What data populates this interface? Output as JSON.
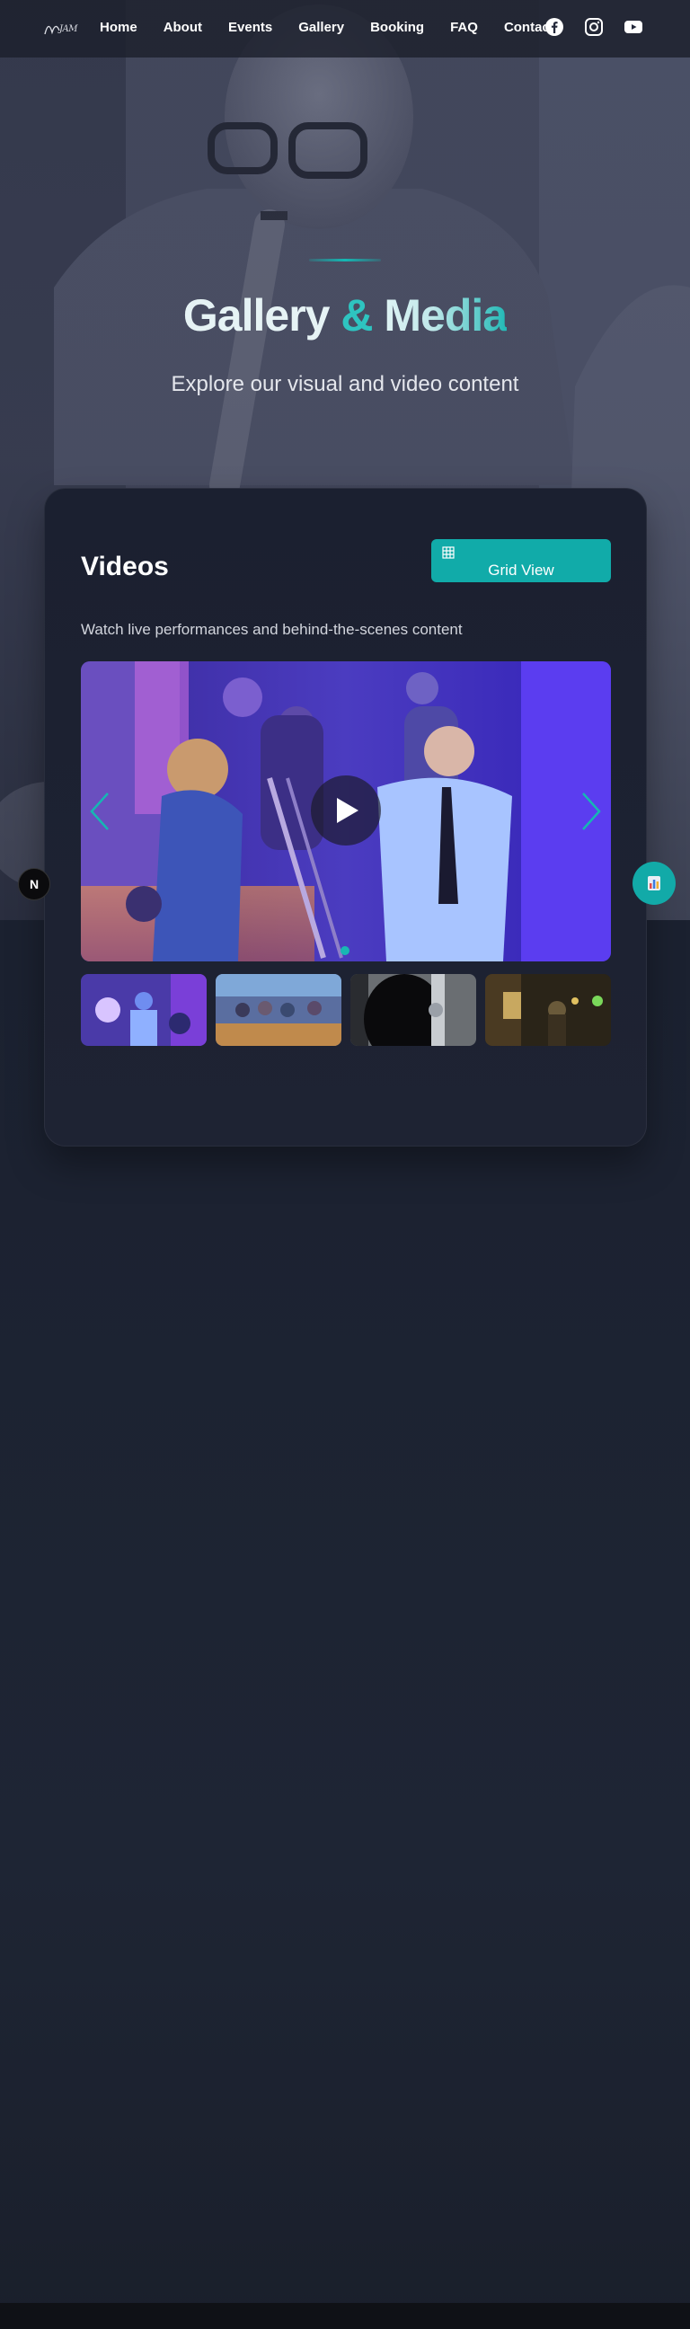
{
  "nav": {
    "logo_text": "JAM",
    "links": [
      "Home",
      "About",
      "Events",
      "Gallery",
      "Booking",
      "FAQ",
      "Contact"
    ],
    "social_icons": [
      "facebook-icon",
      "instagram-icon",
      "youtube-icon"
    ]
  },
  "hero": {
    "title_part1": "Gallery",
    "title_amp": "&",
    "title_part2": "Media",
    "subtitle": "Explore our visual and video content"
  },
  "videos": {
    "title": "Videos",
    "grid_button": "Grid View",
    "description": "Watch live performances and behind-the-scenes content",
    "player_icons": [
      "play-icon",
      "chevron-left-icon",
      "chevron-right-icon"
    ],
    "thumbnail_count": 4
  },
  "floating": {
    "left_badge": "N"
  },
  "colors": {
    "accent": "#12aaa8",
    "panel": "#1b2030",
    "background": "#1a1f2b"
  }
}
